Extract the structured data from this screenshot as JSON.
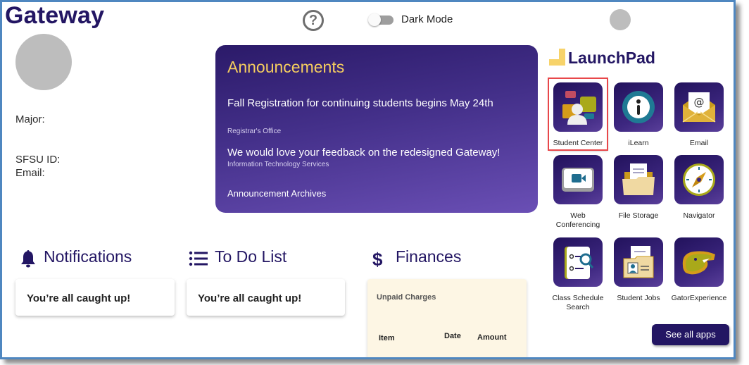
{
  "header": {
    "site_title": "Gateway",
    "help_icon": "question-circle-icon",
    "dark_mode": {
      "label": "Dark Mode",
      "enabled": false
    }
  },
  "profile": {
    "major_label": "Major:",
    "sfsu_id_label": "SFSU ID:",
    "email_label": "Email:"
  },
  "announcements": {
    "title": "Announcements",
    "items": [
      {
        "title": "Fall Registration for continuing students begins May 24th",
        "source": "Registrar's Office"
      },
      {
        "title": "We would love your feedback on the redesigned Gateway!",
        "source": "Information Technology Services"
      }
    ],
    "archive_link": "Announcement Archives"
  },
  "launchpad": {
    "title": "LaunchPad",
    "apps": [
      {
        "label": "Student Center",
        "icon": "student-center-icon",
        "selected": true
      },
      {
        "label": "iLearn",
        "icon": "info-icon",
        "selected": false
      },
      {
        "label": "Email",
        "icon": "envelope-icon",
        "selected": false
      },
      {
        "label": "Web Conferencing",
        "icon": "video-camera-icon",
        "selected": false
      },
      {
        "label": "File Storage",
        "icon": "folder-icon",
        "selected": false
      },
      {
        "label": "Navigator",
        "icon": "compass-icon",
        "selected": false
      },
      {
        "label": "Class Schedule Search",
        "icon": "schedule-search-icon",
        "selected": false
      },
      {
        "label": "Student Jobs",
        "icon": "id-folder-icon",
        "selected": false
      },
      {
        "label": "GatorExperience",
        "icon": "gator-icon",
        "selected": false
      }
    ],
    "see_all_label": "See all apps"
  },
  "notifications": {
    "title": "Notifications",
    "icon": "bell-icon",
    "message": "You’re all caught up!"
  },
  "todo": {
    "title": "To Do List",
    "icon": "list-icon",
    "message": "You’re all caught up!"
  },
  "finances": {
    "title": "Finances",
    "icon": "dollar-icon",
    "subtitle": "Unpaid Charges",
    "columns": [
      "Item",
      "Date",
      "Amount"
    ]
  },
  "colors": {
    "brand_purple": "#231663",
    "accent_gold": "#f5cd5f",
    "selection_red": "#e8474a",
    "frame_blue": "#4f87c0"
  }
}
